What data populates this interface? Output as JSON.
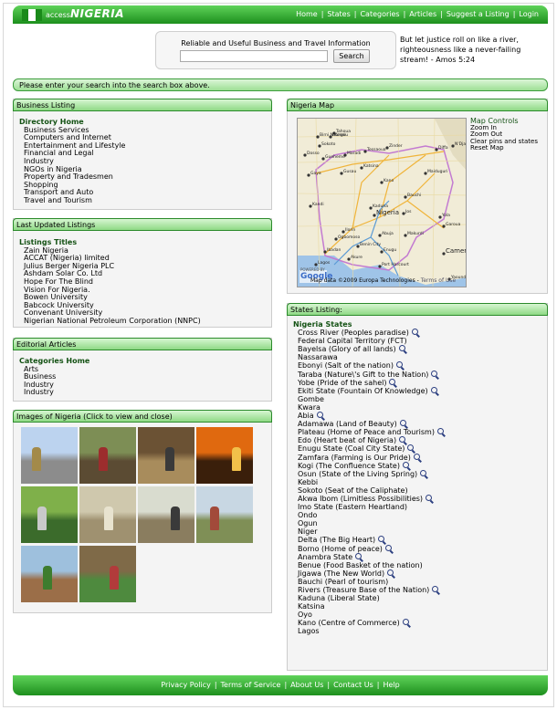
{
  "header": {
    "logo_small": "access",
    "logo_big": "NIGERIA",
    "nav": [
      "Home",
      "States",
      "Categories",
      "Articles",
      "Suggest a Listing",
      "Login"
    ]
  },
  "search": {
    "label": "Reliable and Useful Business and Travel Information",
    "button": "Search",
    "value": ""
  },
  "quote": "But let justice roll on like a river, righteousness like a never-failing stream! - Amos 5:24",
  "notice": "Please enter your search into the search box above.",
  "business": {
    "title": "Business Listing",
    "head": "Directory Home",
    "items": [
      "Business Services",
      "Computers and Internet",
      "Entertainment and Lifestyle",
      "Financial and Legal",
      "Industry",
      "NGOs in Nigeria",
      "Property and Tradesmen",
      "Shopping",
      "Transport and Auto",
      "Travel and Tourism"
    ]
  },
  "updated": {
    "title": "Last Updated Listings",
    "head": "Listings Titles",
    "items": [
      "Zain Nigeria",
      "ACCAT (Nigeria) limited",
      "Julius Berger Nigeria PLC",
      "Ashdam Solar Co. Ltd",
      "Hope For The Blind",
      "Vision For Nigeria.",
      "Bowen University",
      "Babcock University",
      "Convenant University",
      "Nigerian National Petroleum Corporation (NNPC)"
    ]
  },
  "editorial": {
    "title": "Editorial Articles",
    "head": "Categories Home",
    "items": [
      "Arts",
      "Business",
      "Industry",
      "Industry"
    ]
  },
  "images": {
    "title": "Images of Nigeria (Click to view and close)",
    "photos": [
      {
        "sky": "#bcd3ef",
        "ground": "#8c8c8c",
        "accent": "#a38a4a"
      },
      {
        "sky": "#7d8e55",
        "ground": "#5b4b33",
        "accent": "#9c2d2d"
      },
      {
        "sky": "#6b5234",
        "ground": "#a88c5c",
        "accent": "#3a3a3a"
      },
      {
        "sky": "#e0690f",
        "ground": "#3a1f0b",
        "accent": "#f2c14a"
      },
      {
        "sky": "#7fb04a",
        "ground": "#3b6b2b",
        "accent": "#c9c9c9"
      },
      {
        "sky": "#cfc8ad",
        "ground": "#9f9170",
        "accent": "#e8e3cf"
      },
      {
        "sky": "#d9dccf",
        "ground": "#8a7d5f",
        "accent": "#3a3a3a"
      },
      {
        "sky": "#c8d7e3",
        "ground": "#7f8f56",
        "accent": "#a24a3a"
      },
      {
        "sky": "#9ec0dd",
        "ground": "#9b6e48",
        "accent": "#3e7c2e"
      },
      {
        "sky": "#7f6a48",
        "ground": "#4e8a3e",
        "accent": "#b23b3b"
      }
    ]
  },
  "map": {
    "title": "Nigeria Map",
    "controls_title": "Map Controls",
    "controls": [
      "Zoom In",
      "Zoom Out",
      "Clear pins and states",
      "Reset Map"
    ],
    "copyright": "Map data ©2009 Europa Technologies -",
    "terms": "Terms of Use",
    "powered": "POWERED BY",
    "google": "Google",
    "cities": [
      "Birni N'Konni",
      "Tahoua",
      "Dosso",
      "Maradi",
      "Tessaoua",
      "Zinder",
      "Diffa",
      "N'Djamena",
      "Gaya",
      "Kandi",
      "Katsina",
      "Kano",
      "Maiduguri",
      "Sokoto",
      "Gusau",
      "Kaduna",
      "Nigeria",
      "Ilorin",
      "Abuja",
      "Makurdi",
      "Ibadan",
      "Lagos",
      "Benin City",
      "Enugu",
      "Port Harcourt",
      "Cameroon",
      "Yaounde",
      "Bangou",
      "Gueheme",
      "Bauchi",
      "Jos",
      "Yola",
      "Ogbomoso",
      "Akure",
      "Garoua"
    ]
  },
  "states": {
    "title": "States Listing:",
    "head": "Nigeria States",
    "items": [
      {
        "name": "Cross River (Peoples paradise)",
        "icon": true
      },
      {
        "name": "Federal Capital Territory (FCT)",
        "icon": false
      },
      {
        "name": "Bayelsa (Glory of all lands)",
        "icon": true
      },
      {
        "name": "Nassarawa",
        "icon": false
      },
      {
        "name": "Ebonyi (Salt of the nation)",
        "icon": true
      },
      {
        "name": "Taraba (Nature\\'s Gift to the Nation)",
        "icon": true
      },
      {
        "name": "Yobe (Pride of the sahel)",
        "icon": true
      },
      {
        "name": "Ekiti State (Fountain Of Knowledge)",
        "icon": true
      },
      {
        "name": "Gombe",
        "icon": false
      },
      {
        "name": "Kwara",
        "icon": false
      },
      {
        "name": "Abia",
        "icon": true
      },
      {
        "name": "Adamawa (Land of Beauty)",
        "icon": true
      },
      {
        "name": "Plateau (Home of Peace and Tourism)",
        "icon": true
      },
      {
        "name": "Edo (Heart beat of Nigeria)",
        "icon": true
      },
      {
        "name": "Enugu State (Coal City State)",
        "icon": true
      },
      {
        "name": "Zamfara (Farming is Our Pride)",
        "icon": true
      },
      {
        "name": "Kogi (The Confluence State)",
        "icon": true
      },
      {
        "name": "Osun (State of the Living Spring)",
        "icon": true
      },
      {
        "name": "Kebbi",
        "icon": false
      },
      {
        "name": "Sokoto (Seat of the Caliphate)",
        "icon": false
      },
      {
        "name": "Akwa Ibom (Limitless Possibilities)",
        "icon": true
      },
      {
        "name": "Imo State (Eastern Heartland)",
        "icon": false
      },
      {
        "name": "Ondo",
        "icon": false
      },
      {
        "name": "Ogun",
        "icon": false
      },
      {
        "name": "Niger",
        "icon": false
      },
      {
        "name": "Delta (The Big Heart)",
        "icon": true
      },
      {
        "name": "Borno (Home of peace)",
        "icon": true
      },
      {
        "name": "Anambra State",
        "icon": true
      },
      {
        "name": "Benue (Food Basket of the nation)",
        "icon": false
      },
      {
        "name": "Jigawa (The New World)",
        "icon": true
      },
      {
        "name": "Bauchi (Pearl of tourism)",
        "icon": false
      },
      {
        "name": "Rivers (Treasure Base of the Nation)",
        "icon": true
      },
      {
        "name": "Kaduna (Liberal State)",
        "icon": false
      },
      {
        "name": "Katsina",
        "icon": false
      },
      {
        "name": "Oyo",
        "icon": false
      },
      {
        "name": "Kano (Centre of Commerce)",
        "icon": true
      },
      {
        "name": "Lagos",
        "icon": false
      }
    ]
  },
  "footer": {
    "links": [
      "Privacy Policy",
      "Terms of Service",
      "About Us",
      "Contact Us",
      "Help"
    ]
  }
}
